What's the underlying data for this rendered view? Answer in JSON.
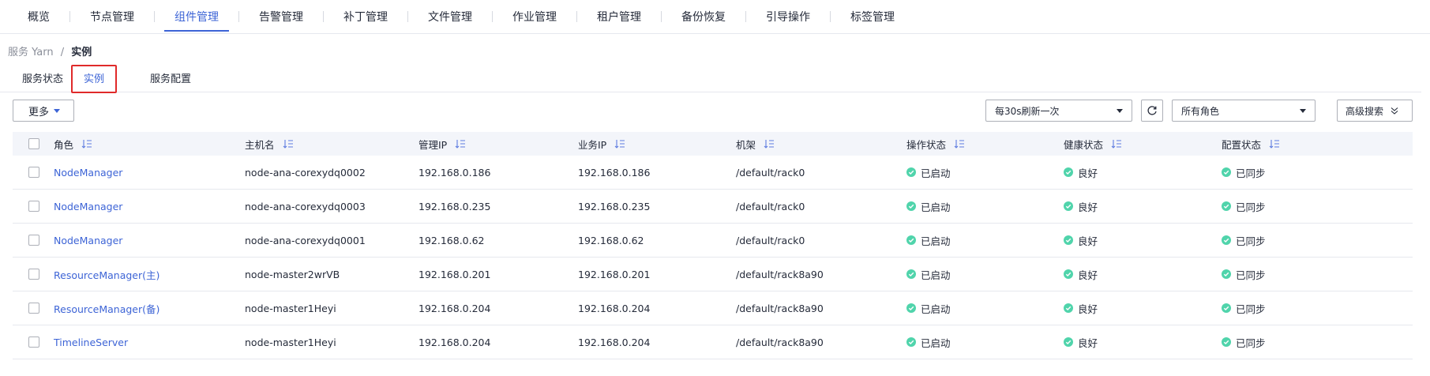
{
  "nav": {
    "items": [
      {
        "label": "概览"
      },
      {
        "label": "节点管理"
      },
      {
        "label": "组件管理",
        "active": true
      },
      {
        "label": "告警管理"
      },
      {
        "label": "补丁管理"
      },
      {
        "label": "文件管理"
      },
      {
        "label": "作业管理"
      },
      {
        "label": "租户管理"
      },
      {
        "label": "备份恢复"
      },
      {
        "label": "引导操作"
      },
      {
        "label": "标签管理"
      }
    ]
  },
  "breadcrumb": {
    "parent": "服务 Yarn",
    "separator": "/",
    "current": "实例"
  },
  "subtabs": [
    {
      "label": "服务状态"
    },
    {
      "label": "实例",
      "active": true
    },
    {
      "label": "服务配置"
    }
  ],
  "toolbar": {
    "more_label": "更多",
    "refresh_select": "每30s刷新一次",
    "role_select": "所有角色",
    "advanced_search": "高级搜索"
  },
  "table": {
    "headers": [
      "角色",
      "主机名",
      "管理IP",
      "业务IP",
      "机架",
      "操作状态",
      "健康状态",
      "配置状态"
    ],
    "rows": [
      {
        "role": "NodeManager",
        "host": "node-ana-corexydq0002",
        "mgmt_ip": "192.168.0.186",
        "biz_ip": "192.168.0.186",
        "rack": "/default/rack0",
        "op_status": "已启动",
        "health": "良好",
        "config": "已同步"
      },
      {
        "role": "NodeManager",
        "host": "node-ana-corexydq0003",
        "mgmt_ip": "192.168.0.235",
        "biz_ip": "192.168.0.235",
        "rack": "/default/rack0",
        "op_status": "已启动",
        "health": "良好",
        "config": "已同步"
      },
      {
        "role": "NodeManager",
        "host": "node-ana-corexydq0001",
        "mgmt_ip": "192.168.0.62",
        "biz_ip": "192.168.0.62",
        "rack": "/default/rack0",
        "op_status": "已启动",
        "health": "良好",
        "config": "已同步"
      },
      {
        "role": "ResourceManager(主)",
        "host": "node-master2wrVB",
        "mgmt_ip": "192.168.0.201",
        "biz_ip": "192.168.0.201",
        "rack": "/default/rack8a90",
        "op_status": "已启动",
        "health": "良好",
        "config": "已同步"
      },
      {
        "role": "ResourceManager(备)",
        "host": "node-master1Heyi",
        "mgmt_ip": "192.168.0.204",
        "biz_ip": "192.168.0.204",
        "rack": "/default/rack8a90",
        "op_status": "已启动",
        "health": "良好",
        "config": "已同步"
      },
      {
        "role": "TimelineServer",
        "host": "node-master1Heyi",
        "mgmt_ip": "192.168.0.204",
        "biz_ip": "192.168.0.204",
        "rack": "/default/rack8a90",
        "op_status": "已启动",
        "health": "良好",
        "config": "已同步"
      }
    ]
  },
  "colors": {
    "accent": "#3d64d6",
    "success": "#50d4ab",
    "highlight_box": "#e02a2a",
    "text": "#252b3a",
    "muted": "#8a8e99"
  },
  "icons": {
    "sort": "sort-icon",
    "status_ok": "check-circle-icon",
    "refresh": "refresh-icon",
    "dropdown": "chevron-down-icon",
    "advanced": "double-chevron-down-icon"
  }
}
